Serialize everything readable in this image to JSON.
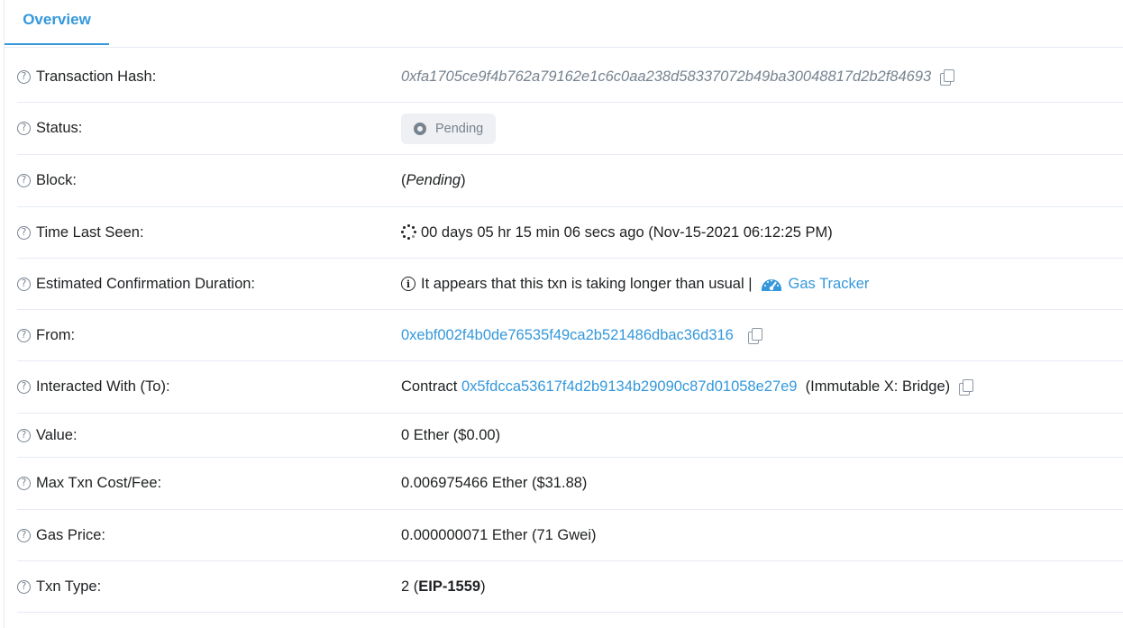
{
  "tabs": {
    "overview": "Overview"
  },
  "rows": {
    "tx_hash": {
      "label": "Transaction Hash:",
      "value": "0xfa1705ce9f4b762a79162e1c6c0aa238d58337072b49ba30048817d2b2f84693"
    },
    "status": {
      "label": "Status:",
      "value": "Pending"
    },
    "block": {
      "label": "Block:",
      "open": "(",
      "value": "Pending",
      "close": ")"
    },
    "time_last_seen": {
      "label": "Time Last Seen:",
      "value": "00 days 05 hr 15 min 06 secs ago (Nov-15-2021 06:12:25 PM)"
    },
    "est_confirmation": {
      "label": "Estimated Confirmation Duration:",
      "message": "It appears that this txn is taking longer than usual |",
      "link": "Gas Tracker"
    },
    "from": {
      "label": "From:",
      "address": "0xebf002f4b0de76535f49ca2b521486dbac36d316"
    },
    "to": {
      "label": "Interacted With (To):",
      "prefix": "Contract",
      "address": "0x5fdcca53617f4d2b9134b29090c87d01058e27e9",
      "name": "(Immutable X: Bridge)"
    },
    "value": {
      "label": "Value:",
      "value": "0 Ether ($0.00)"
    },
    "max_fee": {
      "label": "Max Txn Cost/Fee:",
      "value": "0.006975466 Ether ($31.88)"
    },
    "gas_price": {
      "label": "Gas Price:",
      "value": "0.000000071 Ether (71 Gwei)"
    },
    "txn_type": {
      "label": "Txn Type:",
      "num": "2 (",
      "type": "EIP-1559",
      "close": ")"
    }
  },
  "icons": {
    "help": "?",
    "info": "i"
  },
  "colors": {
    "accent": "#3498db",
    "muted": "#77838f",
    "border": "#e7eaf3",
    "text": "#1e2022"
  }
}
